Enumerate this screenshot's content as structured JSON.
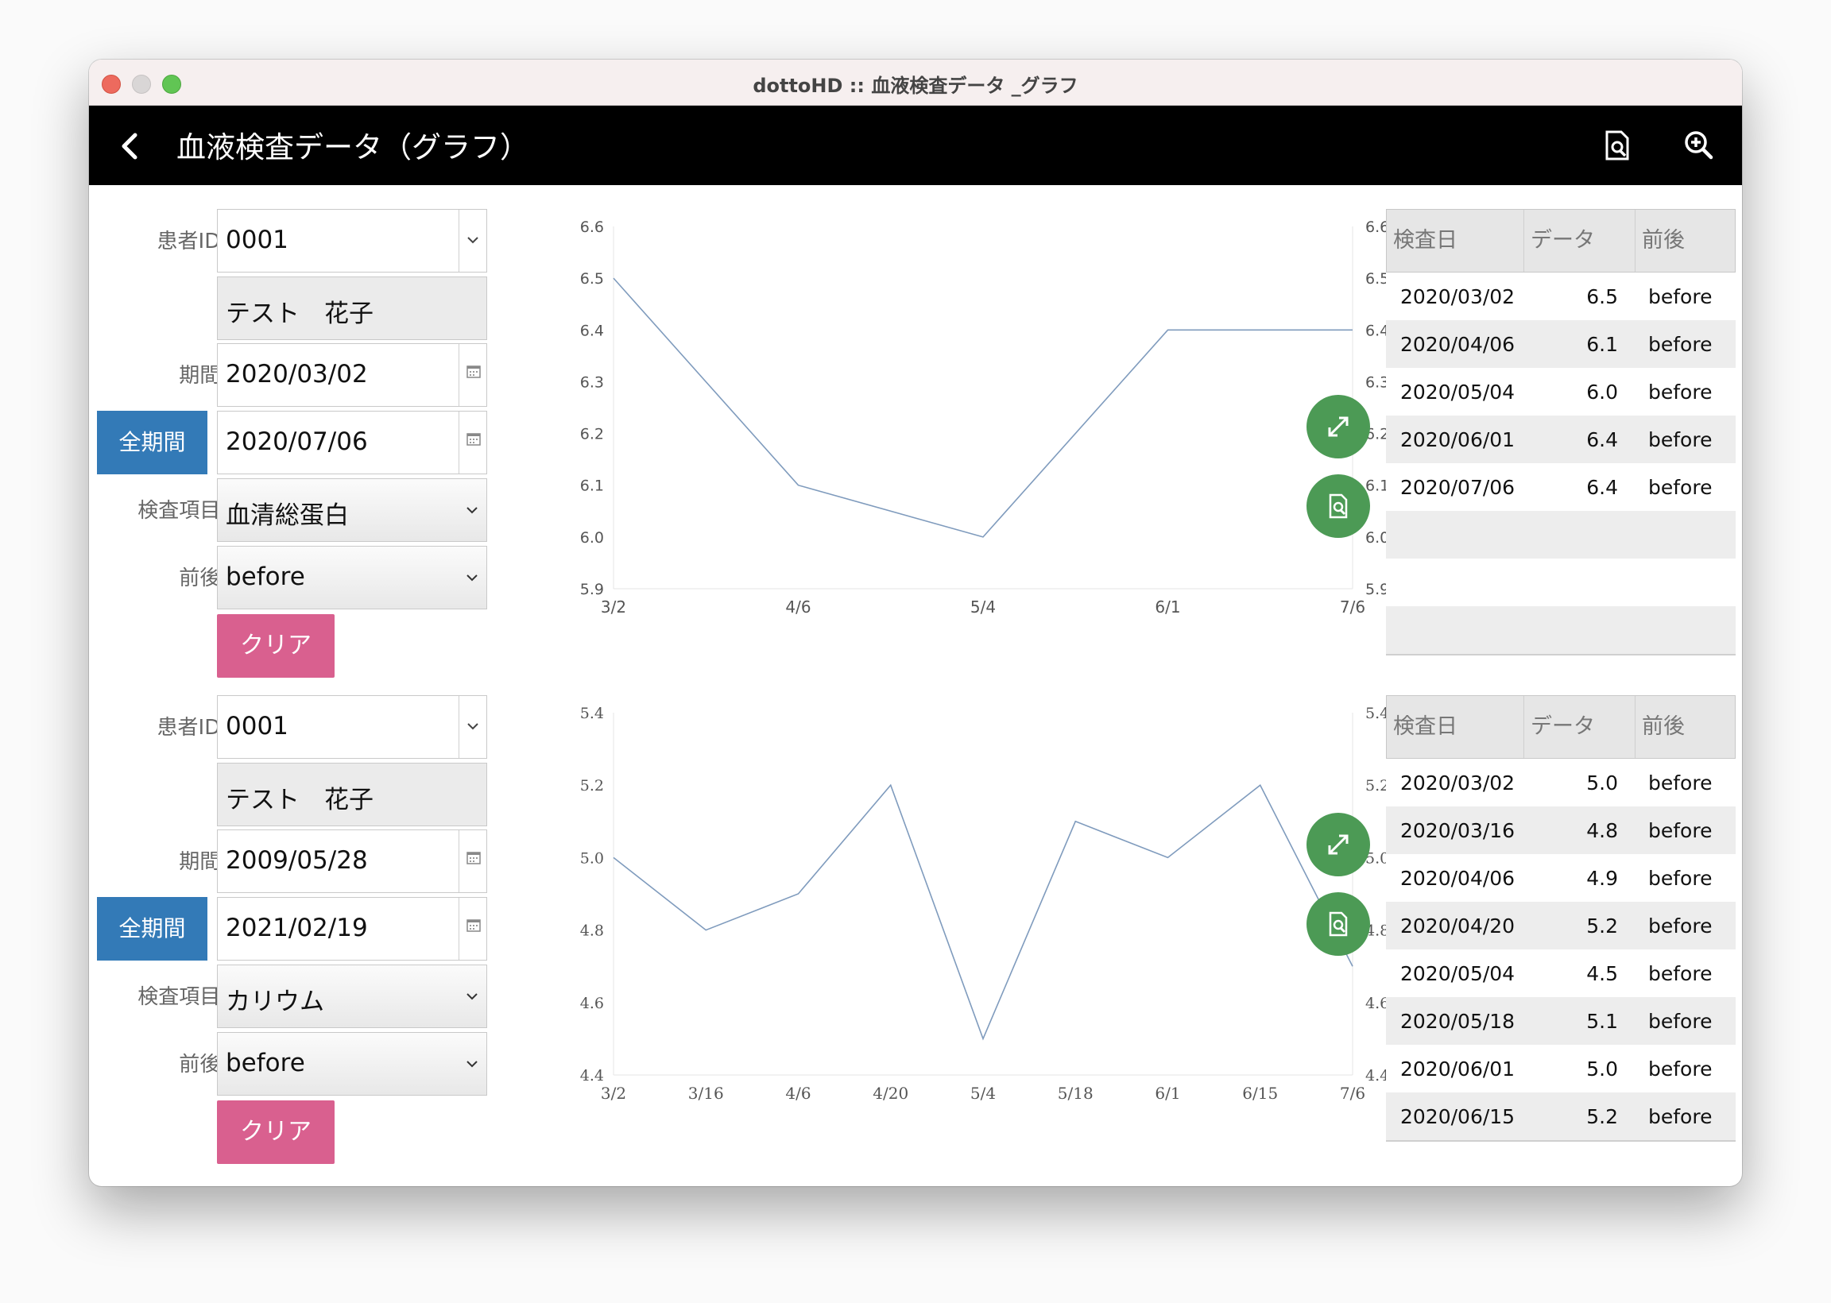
{
  "window": {
    "title": "dottoHD :: 血液検査データ _グラフ"
  },
  "appbar": {
    "title": "血液検査データ（グラフ）"
  },
  "panels": [
    {
      "form": {
        "patient_id_label": "患者ID:",
        "patient_id": "0001",
        "patient_name": "テスト　花子",
        "period_label": "期間:",
        "start_date": "2020/03/02",
        "end_date": "2020/07/06",
        "all_period_button": "全期間",
        "item_label": "検査項目:",
        "item": "血清総蛋白",
        "timing_label": "前後:",
        "timing": "before",
        "clear_button": "クリア"
      },
      "table": {
        "headers": [
          "検査日",
          "データ",
          "前後"
        ],
        "rows": [
          {
            "date": "2020/03/02",
            "value": "6.5",
            "timing": "before"
          },
          {
            "date": "2020/04/06",
            "value": "6.1",
            "timing": "before"
          },
          {
            "date": "2020/05/04",
            "value": "6.0",
            "timing": "before"
          },
          {
            "date": "2020/06/01",
            "value": "6.4",
            "timing": "before"
          },
          {
            "date": "2020/07/06",
            "value": "6.4",
            "timing": "before"
          }
        ],
        "empty_rows": 3
      }
    },
    {
      "form": {
        "patient_id_label": "患者ID:",
        "patient_id": "0001",
        "patient_name": "テスト　花子",
        "period_label": "期間:",
        "start_date": "2009/05/28",
        "end_date": "2021/02/19",
        "all_period_button": "全期間",
        "item_label": "検査項目:",
        "item": "カリウム",
        "timing_label": "前後:",
        "timing": "before",
        "clear_button": "クリア"
      },
      "table": {
        "headers": [
          "検査日",
          "データ",
          "前後"
        ],
        "rows": [
          {
            "date": "2020/03/02",
            "value": "5.0",
            "timing": "before"
          },
          {
            "date": "2020/03/16",
            "value": "4.8",
            "timing": "before"
          },
          {
            "date": "2020/04/06",
            "value": "4.9",
            "timing": "before"
          },
          {
            "date": "2020/04/20",
            "value": "5.2",
            "timing": "before"
          },
          {
            "date": "2020/05/04",
            "value": "4.5",
            "timing": "before"
          },
          {
            "date": "2020/05/18",
            "value": "5.1",
            "timing": "before"
          },
          {
            "date": "2020/06/01",
            "value": "5.0",
            "timing": "before"
          },
          {
            "date": "2020/06/15",
            "value": "5.2",
            "timing": "before"
          }
        ],
        "empty_rows": 0
      }
    }
  ],
  "chart_data": [
    {
      "type": "line",
      "categories": [
        "3/2",
        "4/6",
        "5/4",
        "6/1",
        "7/6"
      ],
      "values": [
        6.5,
        6.1,
        6.0,
        6.4,
        6.4
      ],
      "ylim": [
        5.9,
        6.6
      ],
      "yticks": [
        "5.9",
        "6.0",
        "6.1",
        "6.2",
        "6.3",
        "6.4",
        "6.5",
        "6.6"
      ],
      "grid": false,
      "dual_y_axis": true,
      "line_color": "#7f9bbd"
    },
    {
      "type": "line",
      "categories": [
        "3/2",
        "3/16",
        "4/6",
        "4/20",
        "5/4",
        "5/18",
        "6/1",
        "6/15",
        "7/6"
      ],
      "values": [
        5.0,
        4.8,
        4.9,
        5.2,
        4.5,
        5.1,
        5.0,
        5.2,
        4.7
      ],
      "ylim": [
        4.4,
        5.4
      ],
      "yticks": [
        "4.4",
        "4.6",
        "4.8",
        "5.0",
        "5.2",
        "5.4"
      ],
      "grid": false,
      "dual_y_axis": true,
      "line_color": "#7f9bbd"
    }
  ],
  "colors": {
    "primary_button": "#337ab7",
    "clear_button": "#d9608f",
    "fab": "#4c9a55",
    "appbar": "#000000"
  }
}
